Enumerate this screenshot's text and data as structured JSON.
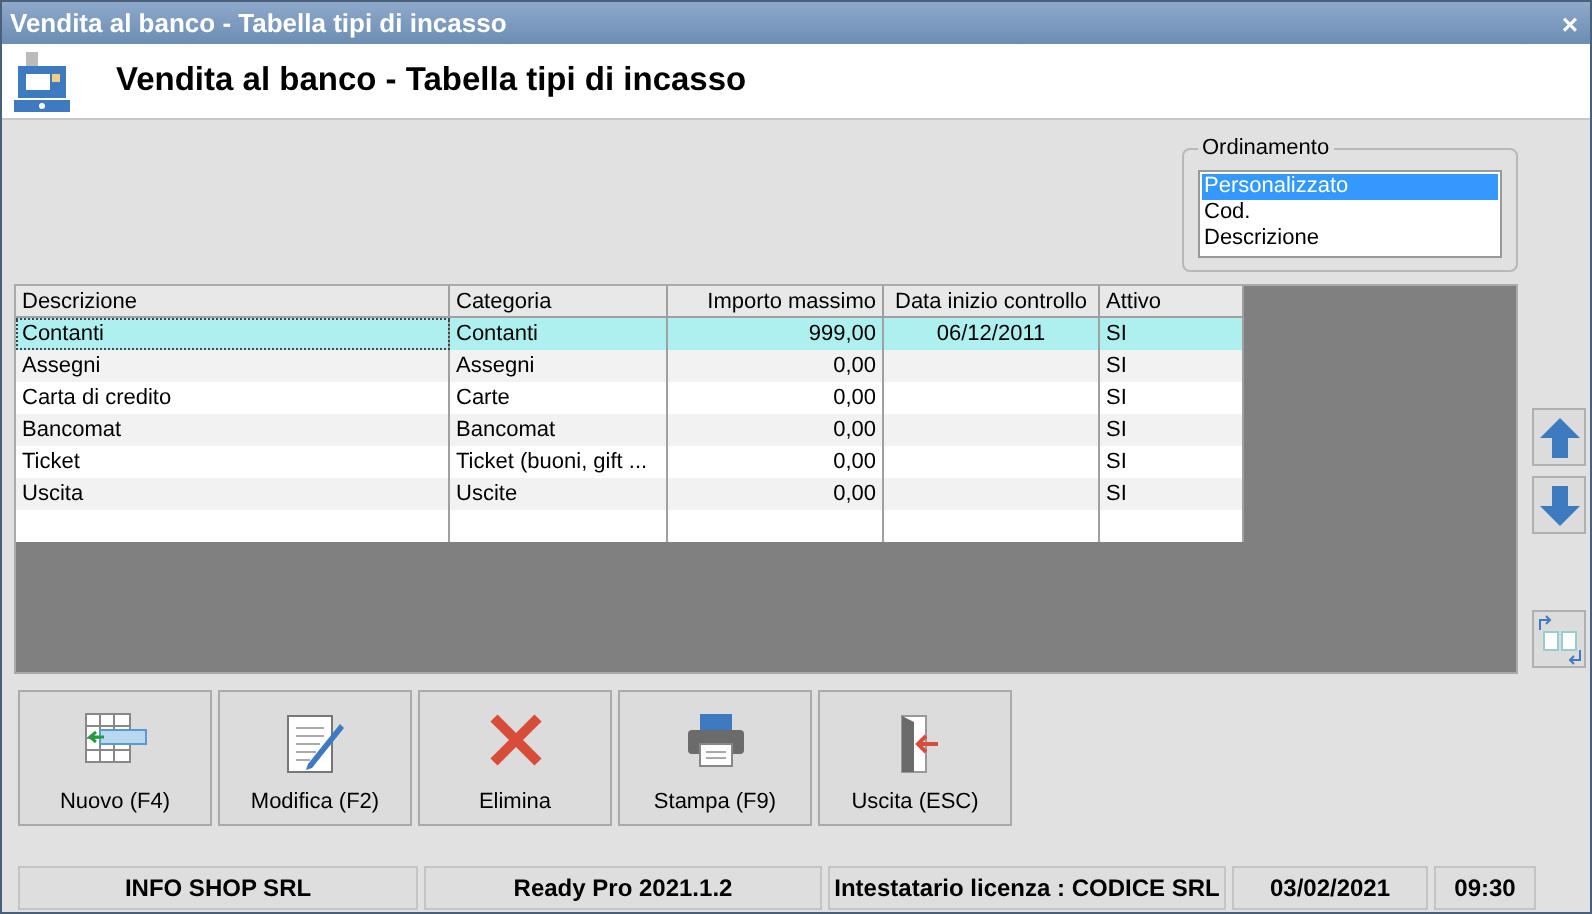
{
  "window": {
    "title": "Vendita al banco - Tabella tipi di incasso",
    "close": "×"
  },
  "header": {
    "title": "Vendita al banco - Tabella tipi di incasso"
  },
  "sort_box": {
    "title": "Ordinamento",
    "options": [
      {
        "label": "Personalizzato",
        "selected": true
      },
      {
        "label": "Cod.",
        "selected": false
      },
      {
        "label": "Descrizione",
        "selected": false
      }
    ]
  },
  "table": {
    "columns": [
      {
        "label": "Descrizione",
        "kind": "text"
      },
      {
        "label": "Categoria",
        "kind": "text"
      },
      {
        "label": "Importo massimo",
        "kind": "number"
      },
      {
        "label": "Data inizio controllo",
        "kind": "date"
      },
      {
        "label": "Attivo",
        "kind": "text"
      }
    ],
    "rows": [
      {
        "cells": [
          "Contanti",
          "Contanti",
          "999,00",
          "06/12/2011",
          "SI"
        ],
        "selected": true
      },
      {
        "cells": [
          "Assegni",
          "Assegni",
          "0,00",
          "",
          "SI"
        ],
        "selected": false
      },
      {
        "cells": [
          "Carta di credito",
          "Carte",
          "0,00",
          "",
          "SI"
        ],
        "selected": false
      },
      {
        "cells": [
          "Bancomat",
          "Bancomat",
          "0,00",
          "",
          "SI"
        ],
        "selected": false
      },
      {
        "cells": [
          "Ticket",
          "Ticket (buoni, gift ...",
          "0,00",
          "",
          "SI"
        ],
        "selected": false
      },
      {
        "cells": [
          "Uscita",
          "Uscite",
          "0,00",
          "",
          "SI"
        ],
        "selected": false
      }
    ]
  },
  "side_buttons": [
    {
      "kind": "up"
    },
    {
      "kind": "down"
    },
    {
      "kind": "swap"
    }
  ],
  "buttons": [
    {
      "label": "Nuovo (F4)",
      "kind": "new"
    },
    {
      "label": "Modifica (F2)",
      "kind": "edit"
    },
    {
      "label": "Elimina",
      "kind": "delete"
    },
    {
      "label": "Stampa (F9)",
      "kind": "print"
    },
    {
      "label": "Uscita (ESC)",
      "kind": "exit"
    }
  ],
  "status_bar": [
    {
      "text": "INFO SHOP SRL"
    },
    {
      "text": "Ready Pro 2021.1.2"
    },
    {
      "text": "Intestatario licenza : CODICE SRL"
    },
    {
      "text": "03/02/2021"
    },
    {
      "text": "09:30"
    }
  ]
}
